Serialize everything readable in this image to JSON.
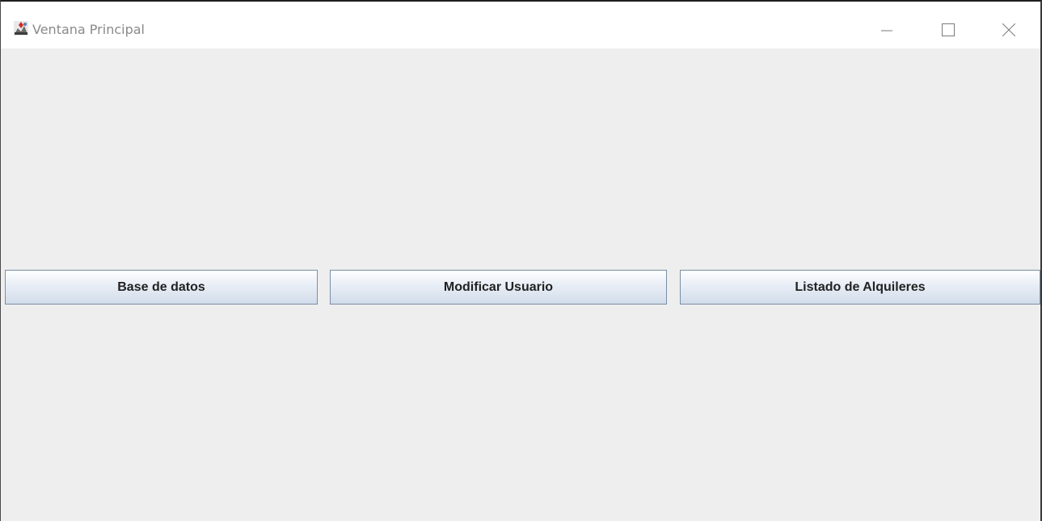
{
  "window": {
    "title": "Ventana Principal",
    "app_icon": "java-duke-icon",
    "controls": {
      "minimize_icon": "minimize-icon",
      "maximize_icon": "maximize-icon",
      "close_icon": "close-icon"
    }
  },
  "main": {
    "buttons": [
      {
        "label": "Base de datos"
      },
      {
        "label": "Modificar Usuario"
      },
      {
        "label": "Listado de Alquileres"
      }
    ]
  },
  "colors": {
    "content_background": "#eeeeee",
    "titlebar_background": "#ffffff",
    "title_text": "#8a8a8a",
    "button_border": "#7a8ea8"
  }
}
